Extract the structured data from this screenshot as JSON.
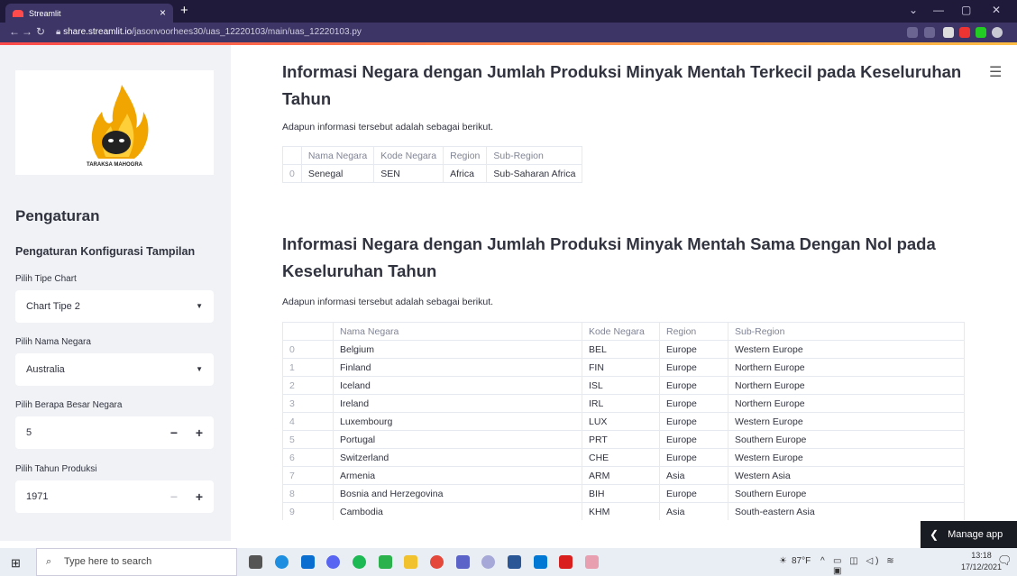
{
  "browser": {
    "tab_title": "Streamlit",
    "tab_close": "×",
    "new_tab": "+",
    "url_domain": "share.streamlit.io",
    "url_path": "/jasonvoorhees30/uas_12220103/main/uas_12220103.py",
    "window_controls": [
      "⌄",
      "—",
      "▢",
      "✕"
    ]
  },
  "sidebar": {
    "logo_text": "TARAKSA MAHOGRA",
    "heading": "Pengaturan",
    "subheading": "Pengaturan Konfigurasi Tampilan",
    "chart_type_label": "Pilih Tipe Chart",
    "chart_type_value": "Chart Tipe 2",
    "country_label": "Pilih Nama Negara",
    "country_value": "Australia",
    "count_label": "Pilih Berapa Besar Negara",
    "count_value": "5",
    "year_label": "Pilih Tahun Produksi",
    "year_value": "1971"
  },
  "main": {
    "section1_title": "Informasi Negara dengan Jumlah Produksi Minyak Mentah Terkecil pada Keseluruhan Tahun",
    "section1_text": "Adapun informasi tersebut adalah sebagai berikut.",
    "section2_title": "Informasi Negara dengan Jumlah Produksi Minyak Mentah Sama Dengan Nol pada Keseluruhan Tahun",
    "section2_text": "Adapun informasi tersebut adalah sebagai berikut.",
    "columns": [
      "Nama Negara",
      "Kode Negara",
      "Region",
      "Sub-Region"
    ],
    "table1_rows": [
      [
        "0",
        "Senegal",
        "SEN",
        "Africa",
        "Sub-Saharan Africa"
      ]
    ],
    "table2_rows": [
      [
        "0",
        "Belgium",
        "BEL",
        "Europe",
        "Western Europe"
      ],
      [
        "1",
        "Finland",
        "FIN",
        "Europe",
        "Northern Europe"
      ],
      [
        "2",
        "Iceland",
        "ISL",
        "Europe",
        "Northern Europe"
      ],
      [
        "3",
        "Ireland",
        "IRL",
        "Europe",
        "Northern Europe"
      ],
      [
        "4",
        "Luxembourg",
        "LUX",
        "Europe",
        "Western Europe"
      ],
      [
        "5",
        "Portugal",
        "PRT",
        "Europe",
        "Southern Europe"
      ],
      [
        "6",
        "Switzerland",
        "CHE",
        "Europe",
        "Western Europe"
      ],
      [
        "7",
        "Armenia",
        "ARM",
        "Asia",
        "Western Asia"
      ],
      [
        "8",
        "Bosnia and Herzegovina",
        "BIH",
        "Europe",
        "Southern Europe"
      ],
      [
        "9",
        "Cambodia",
        "KHM",
        "Asia",
        "South-eastern Asia"
      ]
    ],
    "manage_app": "Manage app"
  },
  "taskbar": {
    "search_placeholder": "Type here to search",
    "weather": "87°F",
    "time": "13:18",
    "date": "17/12/2021"
  },
  "colors": {
    "sidebar_bg": "#f0f2f6",
    "accent_red": "#ff4b4b",
    "text": "#31333f",
    "browser_dark": "#1f1a3a"
  }
}
